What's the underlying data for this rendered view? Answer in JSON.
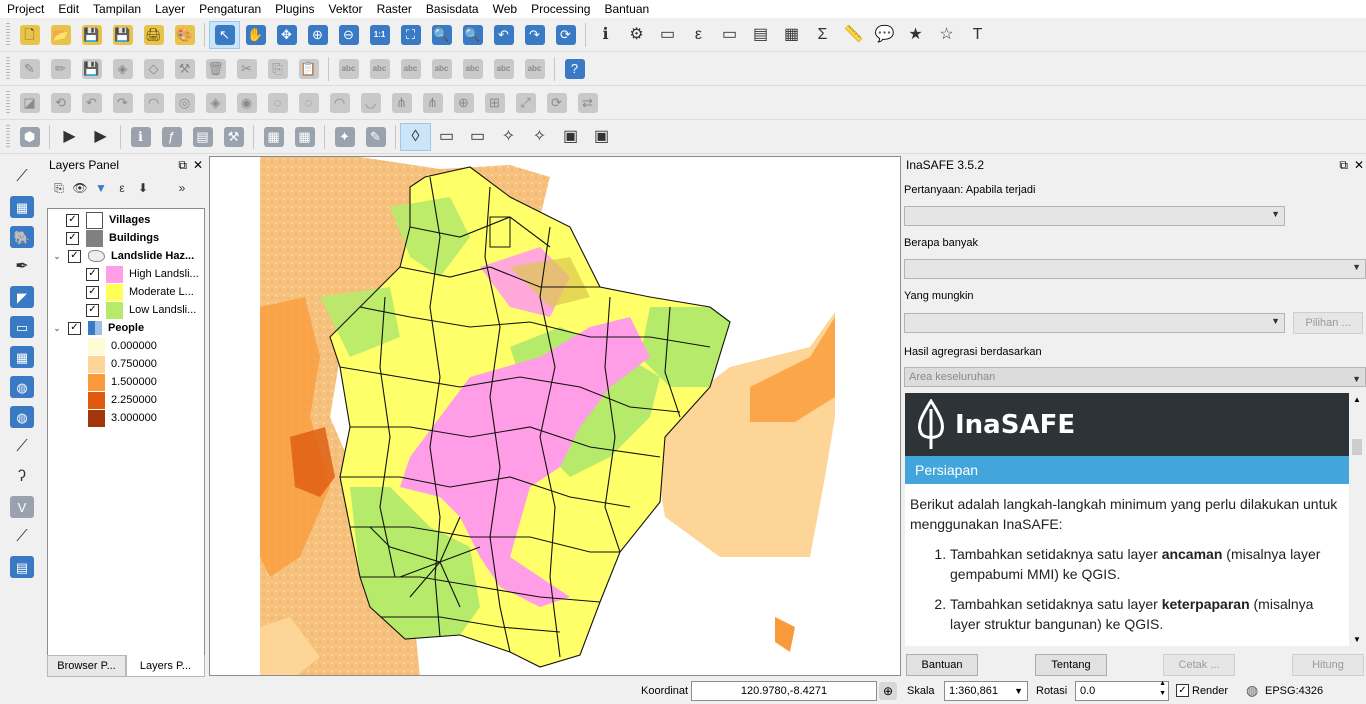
{
  "menu": [
    "Project",
    "Edit",
    "Tampilan",
    "Layer",
    "Pengaturan",
    "Plugins",
    "Vektor",
    "Raster",
    "Basisdata",
    "Web",
    "Processing",
    "Bantuan"
  ],
  "icons": {
    "row1": [
      "new-project-icon",
      "open-project-icon",
      "save-project-icon",
      "save-as-icon",
      "new-print-layout-icon",
      "style-manager-icon",
      "identify-pan-icon",
      "pan-icon",
      "pan-to-selection-icon",
      "zoom-in-icon",
      "zoom-out-icon",
      "zoom-native-icon",
      "zoom-full-icon",
      "zoom-selection-icon",
      "zoom-layer-icon",
      "zoom-last-icon",
      "zoom-next-icon",
      "refresh-icon",
      "identify-icon",
      "settings-icon",
      "select-icon",
      "expression-select-icon",
      "deselect-icon",
      "attribute-table-icon",
      "field-calculator-icon",
      "statistics-icon",
      "measure-icon",
      "map-tips-icon",
      "new-bookmark-icon",
      "bookmarks-icon",
      "text-annotation-icon"
    ],
    "row2": [
      "toggle-editing-icon",
      "pencil-icon",
      "save-edits-icon",
      "add-feature-icon",
      "add-node-icon",
      "node-tool-icon",
      "delete-icon",
      "cut-icon",
      "copy-icon",
      "paste-icon",
      "label-icon",
      "label-pin-icon",
      "label-move-icon",
      "label-show-icon",
      "label-rotate-icon",
      "label-change-icon",
      "label-options-icon",
      "help-icon"
    ],
    "row3": [
      "digitize-icon",
      "rotate-icon",
      "undo-icon",
      "redo-icon",
      "simplify-icon",
      "add-ring-icon",
      "add-part-icon",
      "fill-ring-icon",
      "delete-ring-icon",
      "delete-part-icon",
      "reshape-icon",
      "offset-curve-icon",
      "split-features-icon",
      "split-parts-icon",
      "merge-features-icon",
      "merge-attributes-icon",
      "rotate-point-icon",
      "rotate-features-icon",
      "reverse-line-icon"
    ],
    "row4": [
      "inasafe-icon",
      "add-dock-icon",
      "show-dock-icon",
      "keywords-icon",
      "impact-function-icon",
      "field-mapping-icon",
      "options-icon",
      "shakemap-icon",
      "osm-icon",
      "wizard-icon",
      "metadata-icon",
      "vertex-tool-icon",
      "rectangle-icon",
      "print-icon",
      "magic-wand-icon",
      "select-freehand-icon",
      "layers-icon",
      "add-layer-icon"
    ]
  },
  "layers_panel": {
    "title": "Layers Panel",
    "layers": [
      {
        "name": "Villages",
        "checked": true
      },
      {
        "name": "Buildings",
        "checked": true
      },
      {
        "name": "Landslide Haz...",
        "checked": true,
        "expanded": true
      },
      {
        "name": "High Landsli...",
        "checked": true,
        "color": "#ff9ee6"
      },
      {
        "name": "Moderate L...",
        "checked": true,
        "color": "#ffff55"
      },
      {
        "name": "Low Landsli...",
        "checked": true,
        "color": "#b6ea6a"
      },
      {
        "name": "People",
        "checked": true,
        "expanded": true
      }
    ],
    "legend": [
      {
        "value": "0.000000",
        "color": "#fffbd4"
      },
      {
        "value": "0.750000",
        "color": "#fdd596"
      },
      {
        "value": "1.500000",
        "color": "#fb9a3a"
      },
      {
        "value": "2.250000",
        "color": "#df5a0f"
      },
      {
        "value": "3.000000",
        "color": "#a0360a"
      }
    ],
    "tabs": [
      "Browser P...",
      "Layers P..."
    ]
  },
  "inasafe": {
    "title": "InaSAFE 3.5.2",
    "q1": "Pertanyaan: Apabila terjadi",
    "q2": "Berapa banyak",
    "q3": "Yang mungkin",
    "pilihan": "Pilihan ...",
    "q4": "Hasil agregrasi berdasarkan",
    "aggregation": "Area keseluruhan",
    "logo": "InaSAFE",
    "section": "Persiapan",
    "intro": "Berikut adalah langkah-langkah minimum yang perlu dilakukan untuk menggunakan InaSAFE:",
    "step1_a": "Tambahkan setidaknya satu layer ",
    "step1_b": "ancaman",
    "step1_c": " (misalnya layer gempabumi MMI) ke QGIS.",
    "step2_a": "Tambahkan setidaknya satu layer ",
    "step2_b": "keterpaparan",
    "step2_c": " (misalnya layer struktur bangunan) ke QGIS.",
    "buttons": {
      "bantuan": "Bantuan",
      "tentang": "Tentang",
      "cetak": "Cetak ...",
      "hitung": "Hitung"
    }
  },
  "status": {
    "koordinat_label": "Koordinat",
    "koordinat": "120.9780,-8.4271",
    "skala_label": "Skala",
    "skala": "1:360,861",
    "rotasi_label": "Rotasi",
    "rotasi": "0.0",
    "render": "Render",
    "crs": "EPSG:4326"
  }
}
